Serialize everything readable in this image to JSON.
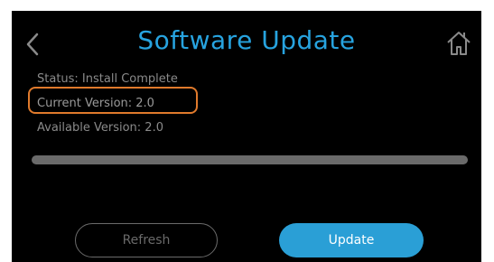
{
  "header": {
    "title": "Software Update",
    "back_icon": "chevron-left-icon",
    "home_icon": "home-icon"
  },
  "info": {
    "status": "Status: Install Complete",
    "current_version": "Current Version: 2.0",
    "available_version": "Available Version: 2.0"
  },
  "progress": {
    "fraction": 1.0
  },
  "buttons": {
    "refresh": "Refresh",
    "update": "Update"
  },
  "colors": {
    "accent": "#27a3df",
    "highlight": "#e07a2c",
    "button_primary": "#2a9fd6",
    "background": "#000000"
  }
}
